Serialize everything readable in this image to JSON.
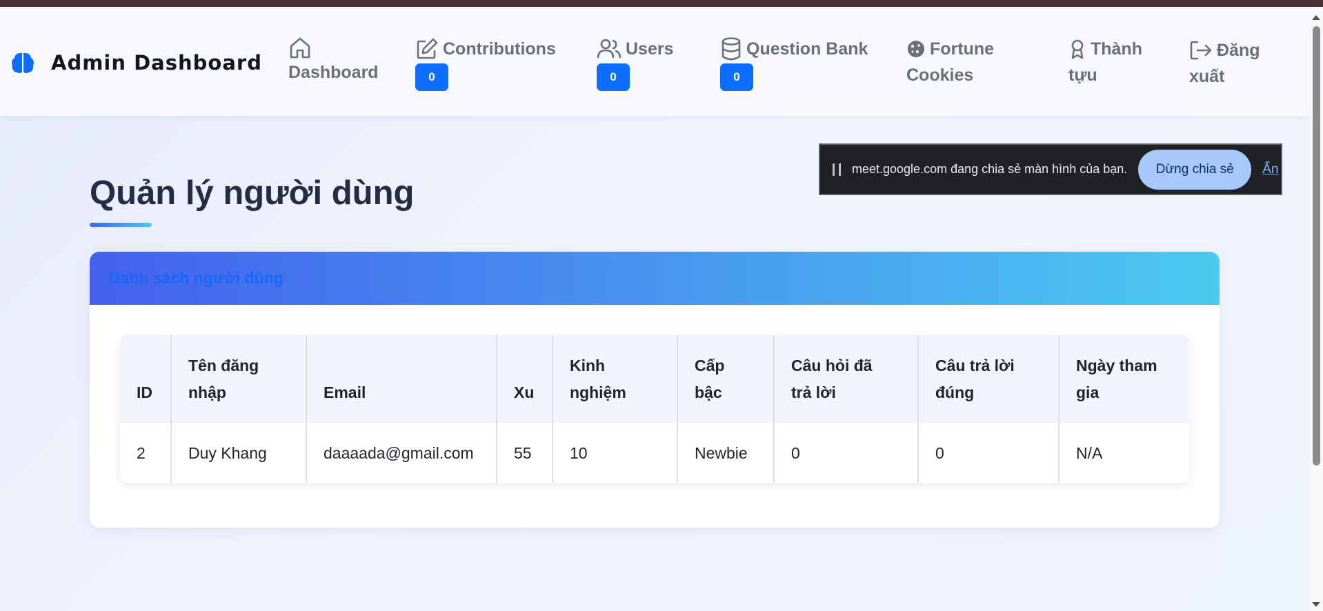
{
  "brand": {
    "title": "Admin Dashboard",
    "icon": "brain-icon"
  },
  "nav": {
    "dashboard": {
      "label": "Dashboard",
      "icon": "house-icon"
    },
    "contributions": {
      "label": "Contributions",
      "badge": "0",
      "icon": "pencil-square-icon"
    },
    "users": {
      "label": "Users",
      "badge": "0",
      "icon": "people-icon"
    },
    "question_bank": {
      "label": "Question Bank",
      "badge": "0",
      "icon": "database-icon"
    },
    "fortune_cookies": {
      "label": "Fortune Cookies",
      "label_line1": "Fortune",
      "label_line2": "Cookies",
      "icon": "cookie-icon"
    },
    "achievements": {
      "label": "Thành tựu",
      "label_line1": "Thành",
      "label_line2": "tựu",
      "icon": "award-icon"
    },
    "logout": {
      "label": "Đăng xuất",
      "label_line1": "Đăng",
      "label_line2": "xuất",
      "icon": "logout-icon"
    }
  },
  "share_bar": {
    "message": "meet.google.com đang chia sẻ màn hình của bạn.",
    "stop_label": "Dừng chia sẻ",
    "hide_label": "Ẩn"
  },
  "page": {
    "title": "Quản lý người dùng"
  },
  "card": {
    "title": "Danh sách người dùng"
  },
  "table": {
    "headers": [
      {
        "line1": "",
        "line2": "ID"
      },
      {
        "line1": "Tên đăng",
        "line2": "nhập"
      },
      {
        "line1": "",
        "line2": "Email"
      },
      {
        "line1": "",
        "line2": "Xu"
      },
      {
        "line1": "Kinh",
        "line2": "nghiệm"
      },
      {
        "line1": "Cấp",
        "line2": "bậc"
      },
      {
        "line1": "Câu hỏi đã",
        "line2": "trả lời"
      },
      {
        "line1": "Câu trả lời",
        "line2": "đúng"
      },
      {
        "line1": "Ngày tham",
        "line2": "gia"
      }
    ],
    "rows": [
      [
        "2",
        "Duy Khang",
        "daaaada@gmail.com",
        "55",
        "10",
        "Newbie",
        "0",
        "0",
        "N/A"
      ]
    ]
  },
  "colors": {
    "accent": "#0d6efd",
    "gradient_start": "#4361ee",
    "gradient_end": "#4cc9f0",
    "share_bar_bg": "#202124",
    "share_stop_bg": "#a8c7fa"
  }
}
